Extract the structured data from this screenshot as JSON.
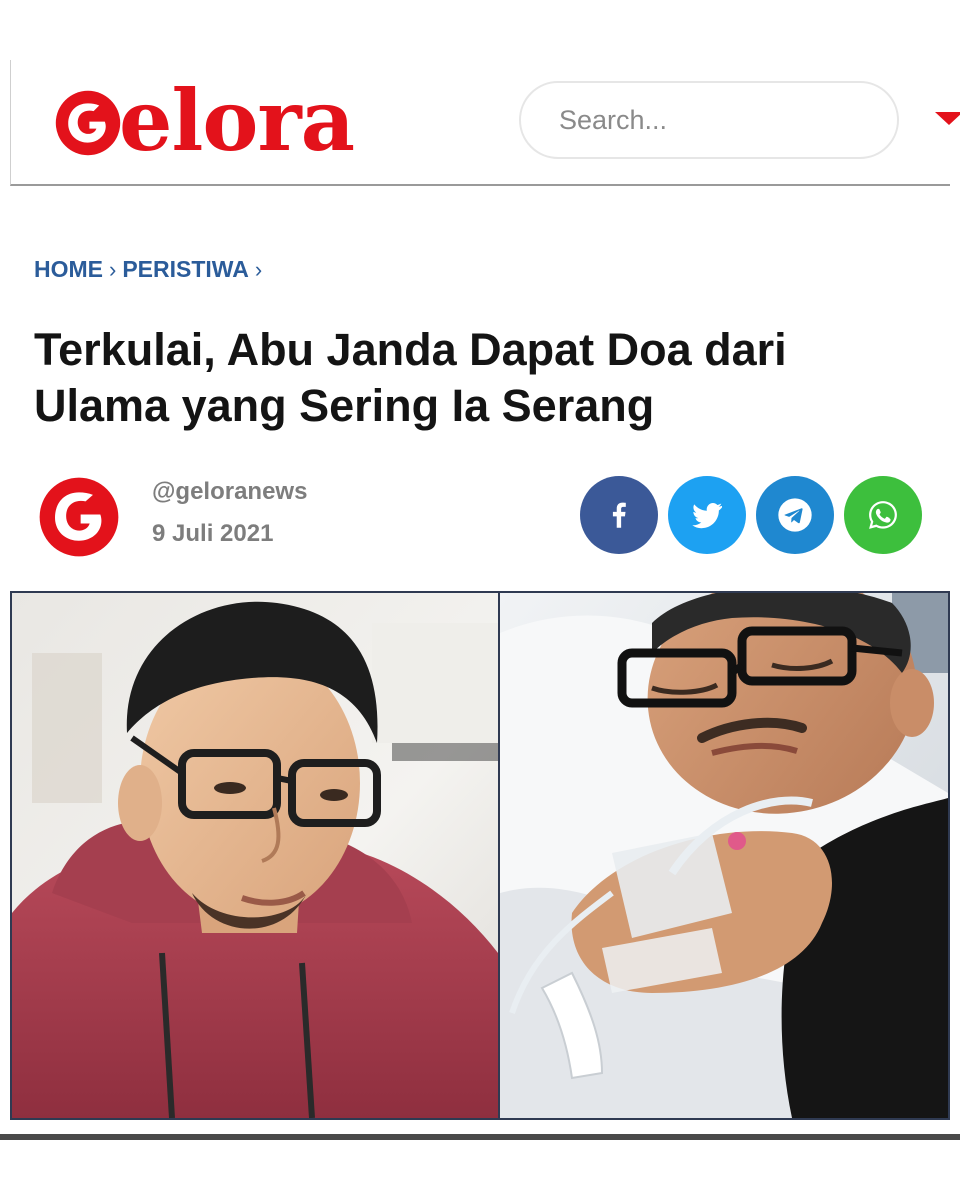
{
  "site": {
    "logo_text": "elora",
    "brand_color": "#e3121b"
  },
  "search": {
    "placeholder": "Search..."
  },
  "breadcrumb": {
    "items": [
      "HOME",
      "PERISTIWA"
    ],
    "separator": "›",
    "color": "#2b5c9a"
  },
  "article": {
    "title": "Terkulai, Abu Janda Dapat Doa dari Ulama yang Sering Ia Serang",
    "author_handle": "@geloranews",
    "date": "9 Juli 2021"
  },
  "share": {
    "buttons": [
      {
        "network": "facebook",
        "icon": "facebook-icon",
        "color": "#3b5998"
      },
      {
        "network": "twitter",
        "icon": "twitter-icon",
        "color": "#1da1f2"
      },
      {
        "network": "telegram",
        "icon": "telegram-icon",
        "color": "#1f88d0"
      },
      {
        "network": "whatsapp",
        "icon": "whatsapp-icon",
        "color": "#3dbf3d"
      }
    ]
  },
  "hero": {
    "panels": [
      "man-in-red-hoodie-with-glasses",
      "man-in-hospital-bed-with-iv-drip"
    ]
  }
}
